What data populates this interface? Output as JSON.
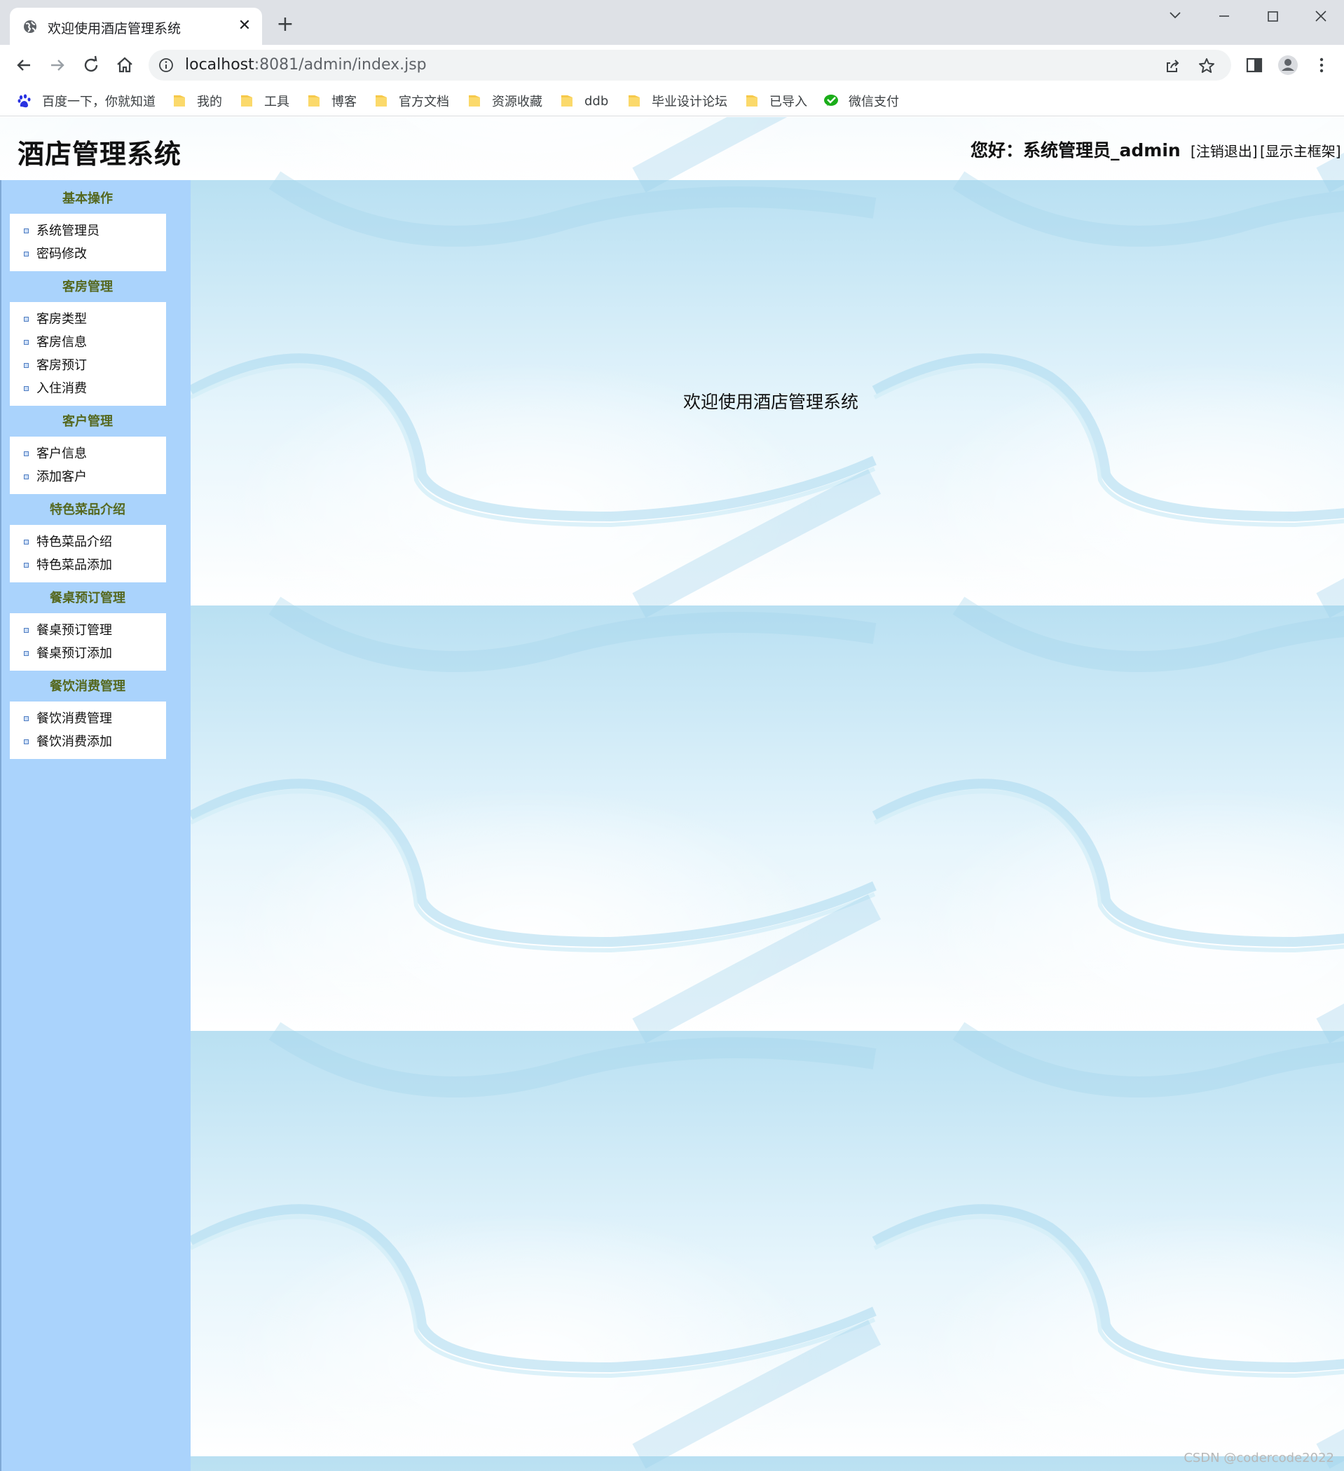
{
  "browser": {
    "tab_title": "欢迎使用酒店管理系统",
    "tab_close": "✕",
    "new_tab": "+",
    "url_host": "localhost",
    "url_rest": ":8081/admin/index.jsp",
    "icons": [
      "globe-icon",
      "back-icon",
      "forward-icon",
      "reload-icon",
      "home-icon",
      "info-icon",
      "share-icon",
      "star-icon",
      "side-panel-icon",
      "profile-icon",
      "menu-icon"
    ],
    "bookmarks": [
      {
        "label": "百度一下，你就知道",
        "icon": "baidu-icon"
      },
      {
        "label": "我的",
        "icon": "folder-icon"
      },
      {
        "label": "工具",
        "icon": "folder-icon"
      },
      {
        "label": "博客",
        "icon": "folder-icon"
      },
      {
        "label": "官方文档",
        "icon": "folder-icon"
      },
      {
        "label": "资源收藏",
        "icon": "folder-icon"
      },
      {
        "label": "ddb",
        "icon": "folder-icon"
      },
      {
        "label": "毕业设计论坛",
        "icon": "folder-icon"
      },
      {
        "label": "已导入",
        "icon": "folder-icon"
      },
      {
        "label": "微信支付",
        "icon": "wechat-pay-icon"
      }
    ]
  },
  "header": {
    "title": "酒店管理系统",
    "greeting": "您好：系统管理员_admin",
    "logout": "[注销退出]",
    "show_frame": "[显示主框架]"
  },
  "sidebar": {
    "groups": [
      {
        "heading": "基本操作",
        "items": [
          "系统管理员",
          "密码修改"
        ]
      },
      {
        "heading": "客房管理",
        "items": [
          "客房类型",
          "客房信息",
          "客房预订",
          "入住消费"
        ]
      },
      {
        "heading": "客户管理",
        "items": [
          "客户信息",
          "添加客户"
        ]
      },
      {
        "heading": "特色菜品介绍",
        "items": [
          "特色菜品介绍",
          "特色菜品添加"
        ]
      },
      {
        "heading": "餐桌预订管理",
        "items": [
          "餐桌预订管理",
          "餐桌预订添加"
        ]
      },
      {
        "heading": "餐饮消费管理",
        "items": [
          "餐饮消费管理",
          "餐饮消费添加"
        ]
      }
    ]
  },
  "main": {
    "welcome": "欢迎使用酒店管理系统"
  },
  "watermark": "CSDN @codercode2022",
  "colors": {
    "sidebar_bg": "#aad3fc",
    "heading_text": "#55681f",
    "tabbar_bg": "#dee1e6",
    "page_bg": "#cfeaf6"
  }
}
